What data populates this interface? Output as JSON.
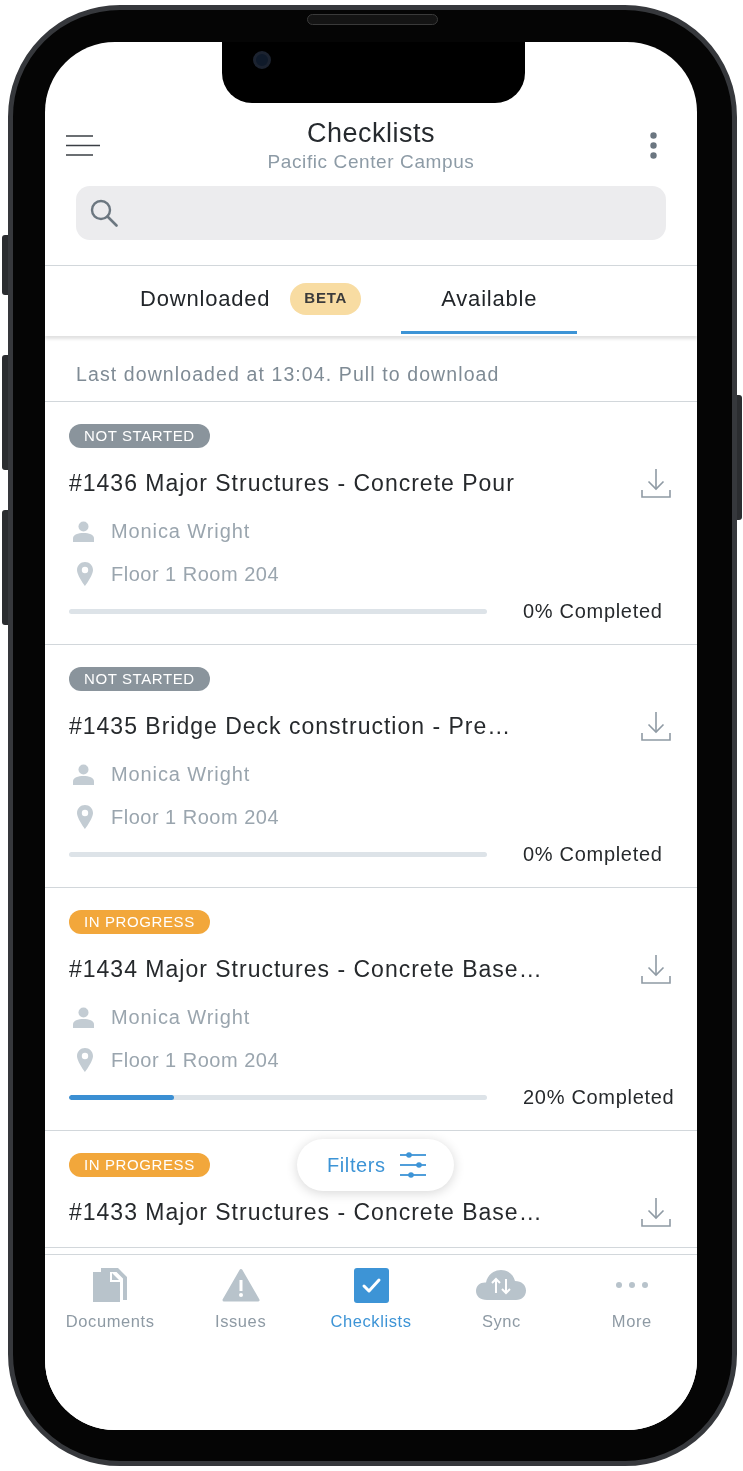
{
  "header": {
    "title": "Checklists",
    "subtitle": "Pacific Center Campus"
  },
  "tabs": [
    {
      "label": "Downloaded",
      "badge": "BETA",
      "selected": false
    },
    {
      "label": "Available",
      "selected": true
    }
  ],
  "sync_note": "Last downloaded at 13:04. Pull to download",
  "checklists": [
    {
      "status": "NOT STARTED",
      "color": "#8a949c",
      "title": "#1436 Major Structures - Concrete Pour",
      "assignee": "Monica Wright",
      "location": "Floor 1 Room 204",
      "level": 0,
      "progress": "0% Completed"
    },
    {
      "status": "NOT STARTED",
      "color": "#8a949c",
      "title": "#1435 Bridge Deck construction - Pre…",
      "assignee": "Monica Wright",
      "location": "Floor 1 Room 204",
      "level": 0,
      "progress": "0% Completed"
    },
    {
      "status": "IN PROGRESS",
      "color": "#f2a73b",
      "title": "#1434 Major Structures - Concrete Base…",
      "assignee": "Monica Wright",
      "location": "Floor 1 Room 204",
      "level": 0.25,
      "progress": "20% Completed"
    },
    {
      "status": "IN PROGRESS",
      "color": "#f2a73b",
      "title": "#1433 Major Structures - Concrete Base…"
    }
  ],
  "filters_button": {
    "label": "Filters"
  },
  "nav": [
    {
      "label": "Documents",
      "selected": false
    },
    {
      "label": "Issues",
      "selected": false
    },
    {
      "label": "Checklists",
      "selected": true
    },
    {
      "label": "Sync",
      "selected": false
    },
    {
      "label": "More",
      "selected": false
    }
  ]
}
